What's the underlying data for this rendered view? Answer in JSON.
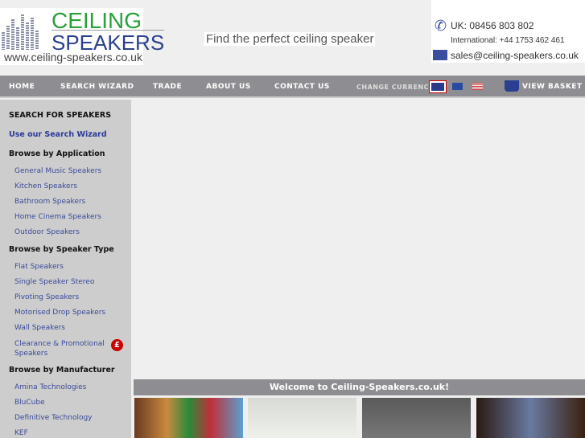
{
  "logo": {
    "line1": "CEILING",
    "line2": "SPEAKERS",
    "url": "www.ceiling-speakers.co.uk"
  },
  "tagline": "Find the perfect ceiling speaker",
  "contact": {
    "uk": "UK: 08456 803 802",
    "intl": "International: +44 1753 462 461",
    "email": "sales@ceiling-speakers.co.uk"
  },
  "nav": {
    "home": "HOME",
    "wizard": "SEARCH WIZARD",
    "trade": "TRADE",
    "about": "ABOUT US",
    "contact": "CONTACT US",
    "currency": "CHANGE CURRENCY:",
    "basket": "VIEW BASKET"
  },
  "sidebar": {
    "title": "SEARCH FOR SPEAKERS",
    "wizard": "Use our Search Wizard",
    "app_heading": "Browse by Application",
    "app": [
      "General Music Speakers",
      "Kitchen Speakers",
      "Bathroom Speakers",
      "Home Cinema Speakers",
      "Outdoor Speakers"
    ],
    "type_heading": "Browse by Speaker Type",
    "type": [
      "Flat Speakers",
      "Single Speaker Stereo",
      "Pivoting Speakers",
      "Motorised Drop Speakers",
      "Wall Speakers",
      "Clearance & Promotional Speakers"
    ],
    "man_heading": "Browse by Manufacturer",
    "man": [
      "Amina Technologies",
      "BluCube",
      "Definitive Technology",
      "KEF"
    ],
    "pound": "£"
  },
  "welcome": "Welcome to Ceiling-Speakers.co.uk!"
}
